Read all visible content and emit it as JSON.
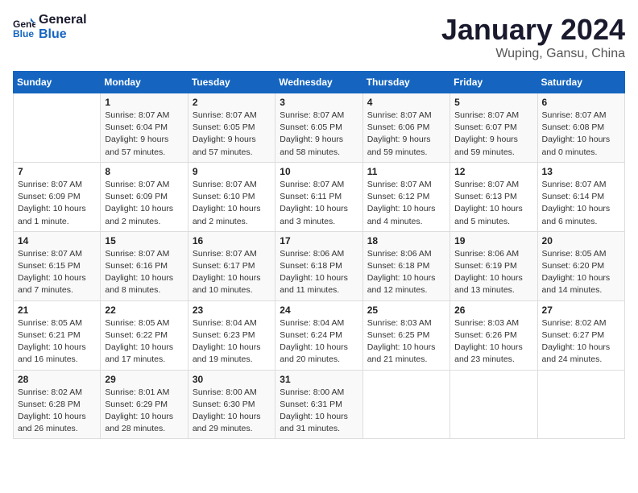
{
  "header": {
    "logo_line1": "General",
    "logo_line2": "Blue",
    "month": "January 2024",
    "location": "Wuping, Gansu, China"
  },
  "weekdays": [
    "Sunday",
    "Monday",
    "Tuesday",
    "Wednesday",
    "Thursday",
    "Friday",
    "Saturday"
  ],
  "weeks": [
    [
      {
        "day": "",
        "info": ""
      },
      {
        "day": "1",
        "info": "Sunrise: 8:07 AM\nSunset: 6:04 PM\nDaylight: 9 hours\nand 57 minutes."
      },
      {
        "day": "2",
        "info": "Sunrise: 8:07 AM\nSunset: 6:05 PM\nDaylight: 9 hours\nand 57 minutes."
      },
      {
        "day": "3",
        "info": "Sunrise: 8:07 AM\nSunset: 6:05 PM\nDaylight: 9 hours\nand 58 minutes."
      },
      {
        "day": "4",
        "info": "Sunrise: 8:07 AM\nSunset: 6:06 PM\nDaylight: 9 hours\nand 59 minutes."
      },
      {
        "day": "5",
        "info": "Sunrise: 8:07 AM\nSunset: 6:07 PM\nDaylight: 9 hours\nand 59 minutes."
      },
      {
        "day": "6",
        "info": "Sunrise: 8:07 AM\nSunset: 6:08 PM\nDaylight: 10 hours\nand 0 minutes."
      }
    ],
    [
      {
        "day": "7",
        "info": "Sunrise: 8:07 AM\nSunset: 6:09 PM\nDaylight: 10 hours\nand 1 minute."
      },
      {
        "day": "8",
        "info": "Sunrise: 8:07 AM\nSunset: 6:09 PM\nDaylight: 10 hours\nand 2 minutes."
      },
      {
        "day": "9",
        "info": "Sunrise: 8:07 AM\nSunset: 6:10 PM\nDaylight: 10 hours\nand 2 minutes."
      },
      {
        "day": "10",
        "info": "Sunrise: 8:07 AM\nSunset: 6:11 PM\nDaylight: 10 hours\nand 3 minutes."
      },
      {
        "day": "11",
        "info": "Sunrise: 8:07 AM\nSunset: 6:12 PM\nDaylight: 10 hours\nand 4 minutes."
      },
      {
        "day": "12",
        "info": "Sunrise: 8:07 AM\nSunset: 6:13 PM\nDaylight: 10 hours\nand 5 minutes."
      },
      {
        "day": "13",
        "info": "Sunrise: 8:07 AM\nSunset: 6:14 PM\nDaylight: 10 hours\nand 6 minutes."
      }
    ],
    [
      {
        "day": "14",
        "info": "Sunrise: 8:07 AM\nSunset: 6:15 PM\nDaylight: 10 hours\nand 7 minutes."
      },
      {
        "day": "15",
        "info": "Sunrise: 8:07 AM\nSunset: 6:16 PM\nDaylight: 10 hours\nand 8 minutes."
      },
      {
        "day": "16",
        "info": "Sunrise: 8:07 AM\nSunset: 6:17 PM\nDaylight: 10 hours\nand 10 minutes."
      },
      {
        "day": "17",
        "info": "Sunrise: 8:06 AM\nSunset: 6:18 PM\nDaylight: 10 hours\nand 11 minutes."
      },
      {
        "day": "18",
        "info": "Sunrise: 8:06 AM\nSunset: 6:18 PM\nDaylight: 10 hours\nand 12 minutes."
      },
      {
        "day": "19",
        "info": "Sunrise: 8:06 AM\nSunset: 6:19 PM\nDaylight: 10 hours\nand 13 minutes."
      },
      {
        "day": "20",
        "info": "Sunrise: 8:05 AM\nSunset: 6:20 PM\nDaylight: 10 hours\nand 14 minutes."
      }
    ],
    [
      {
        "day": "21",
        "info": "Sunrise: 8:05 AM\nSunset: 6:21 PM\nDaylight: 10 hours\nand 16 minutes."
      },
      {
        "day": "22",
        "info": "Sunrise: 8:05 AM\nSunset: 6:22 PM\nDaylight: 10 hours\nand 17 minutes."
      },
      {
        "day": "23",
        "info": "Sunrise: 8:04 AM\nSunset: 6:23 PM\nDaylight: 10 hours\nand 19 minutes."
      },
      {
        "day": "24",
        "info": "Sunrise: 8:04 AM\nSunset: 6:24 PM\nDaylight: 10 hours\nand 20 minutes."
      },
      {
        "day": "25",
        "info": "Sunrise: 8:03 AM\nSunset: 6:25 PM\nDaylight: 10 hours\nand 21 minutes."
      },
      {
        "day": "26",
        "info": "Sunrise: 8:03 AM\nSunset: 6:26 PM\nDaylight: 10 hours\nand 23 minutes."
      },
      {
        "day": "27",
        "info": "Sunrise: 8:02 AM\nSunset: 6:27 PM\nDaylight: 10 hours\nand 24 minutes."
      }
    ],
    [
      {
        "day": "28",
        "info": "Sunrise: 8:02 AM\nSunset: 6:28 PM\nDaylight: 10 hours\nand 26 minutes."
      },
      {
        "day": "29",
        "info": "Sunrise: 8:01 AM\nSunset: 6:29 PM\nDaylight: 10 hours\nand 28 minutes."
      },
      {
        "day": "30",
        "info": "Sunrise: 8:00 AM\nSunset: 6:30 PM\nDaylight: 10 hours\nand 29 minutes."
      },
      {
        "day": "31",
        "info": "Sunrise: 8:00 AM\nSunset: 6:31 PM\nDaylight: 10 hours\nand 31 minutes."
      },
      {
        "day": "",
        "info": ""
      },
      {
        "day": "",
        "info": ""
      },
      {
        "day": "",
        "info": ""
      }
    ]
  ]
}
